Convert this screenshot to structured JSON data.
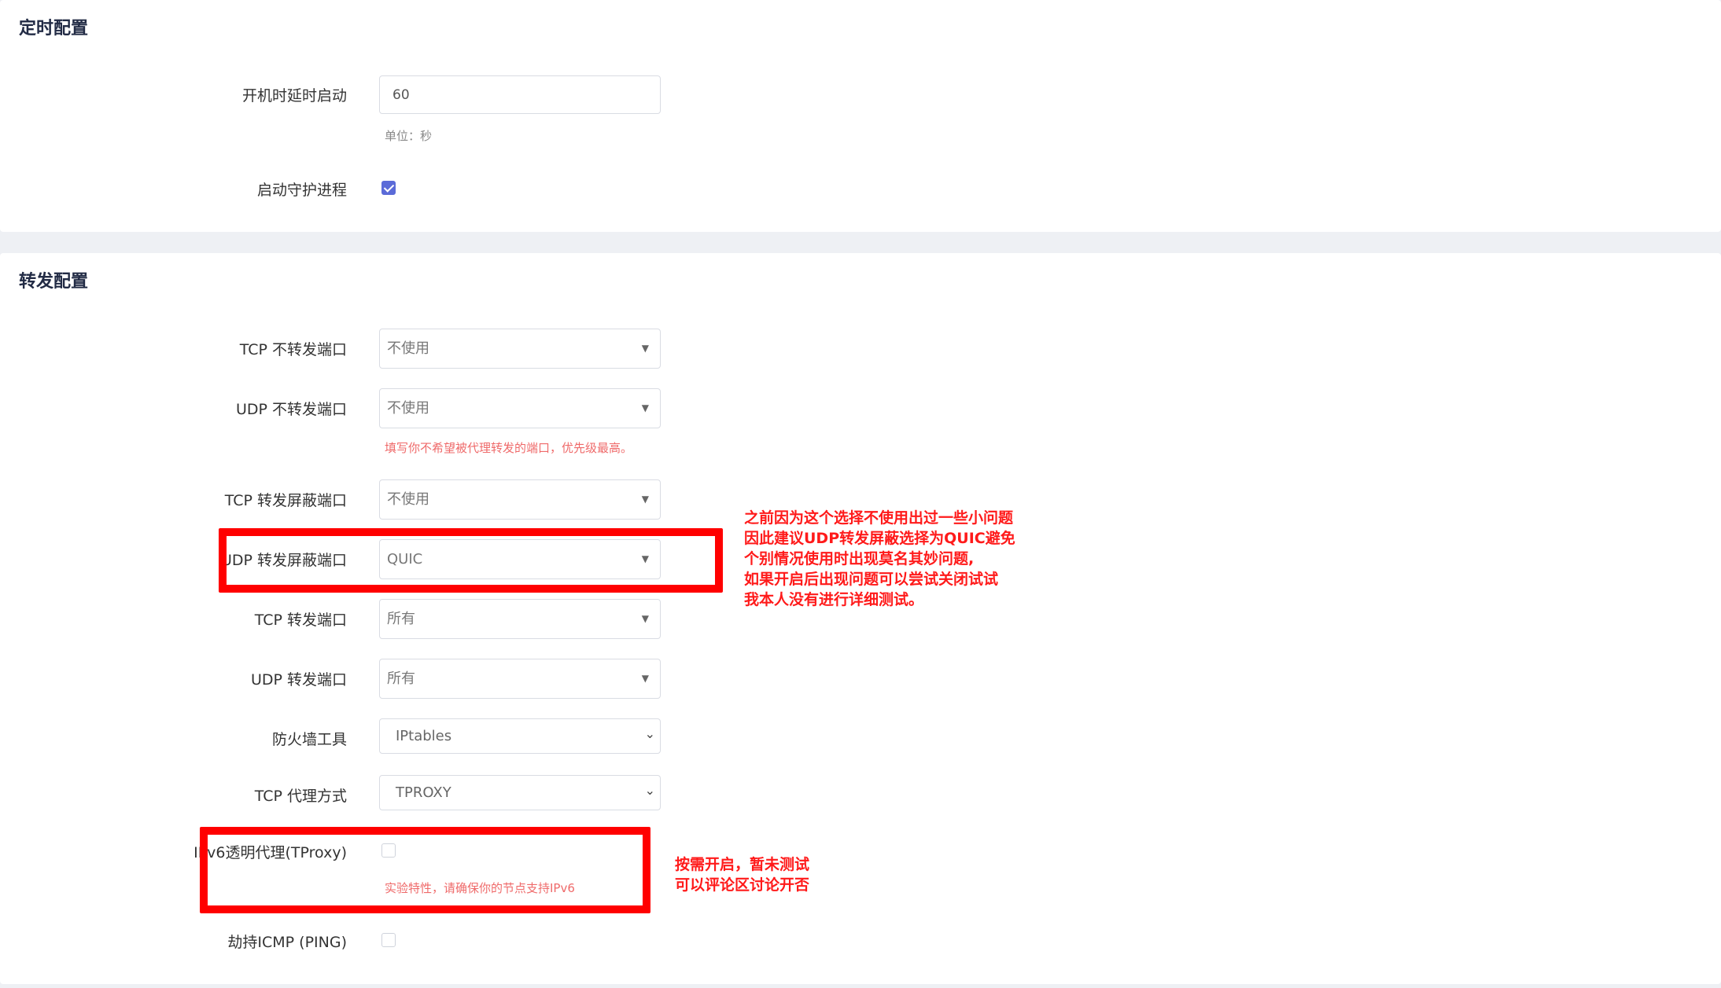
{
  "timer_section": {
    "title": "定时配置",
    "boot_delay": {
      "label": "开机时延时启动",
      "value": "60",
      "hint": "单位：秒"
    },
    "daemon": {
      "label": "启动守护进程",
      "checked": true
    }
  },
  "forward_section": {
    "title": "转发配置",
    "tcp_no_forward": {
      "label": "TCP 不转发端口",
      "value": "不使用"
    },
    "udp_no_forward": {
      "label": "UDP 不转发端口",
      "value": "不使用",
      "hint": "填写你不希望被代理转发的端口，优先级最高。"
    },
    "tcp_block": {
      "label": "TCP 转发屏蔽端口",
      "value": "不使用"
    },
    "udp_block": {
      "label": "UDP 转发屏蔽端口",
      "value": "QUIC"
    },
    "tcp_forward": {
      "label": "TCP 转发端口",
      "value": "所有"
    },
    "udp_forward": {
      "label": "UDP 转发端口",
      "value": "所有"
    },
    "firewall": {
      "label": "防火墙工具",
      "value": "IPtables"
    },
    "tcp_proxy_mode": {
      "label": "TCP 代理方式",
      "value": "TPROXY"
    },
    "ipv6_tproxy": {
      "label": "IPv6透明代理(TProxy)",
      "checked": false,
      "hint": "实验特性，请确保你的节点支持IPv6"
    },
    "icmp": {
      "label": "劫持ICMP (PING)",
      "checked": false
    }
  },
  "annotations": {
    "udp_note": [
      "之前因为这个选择不使用出过一些小问题",
      "因此建议UDP转发屏蔽选择为QUIC避免",
      "个别情况使用时出现莫名其妙问题,",
      "如果开启后出现问题可以尝试关闭试试",
      "我本人没有进行详细测试。"
    ],
    "ipv6_note": [
      "按需开启，暂未测试",
      "可以评论区讨论开否"
    ]
  },
  "colors": {
    "accent": "#5b6bd8",
    "annotation": "#ff0000",
    "warn_hint": "#ef6a6a"
  },
  "icons": {
    "select_caret": "▼",
    "dropdown_chevron": "⌄"
  }
}
